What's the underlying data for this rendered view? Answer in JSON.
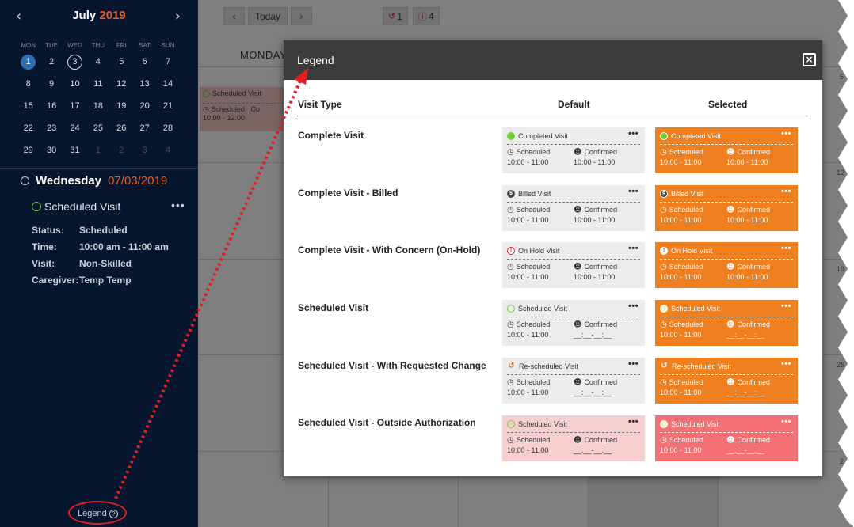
{
  "sidebar": {
    "month": "July",
    "year": "2019",
    "prev_icon": "chevron-left-icon",
    "next_icon": "chevron-right-icon",
    "weekdays": [
      "MON",
      "TUE",
      "WED",
      "THU",
      "FRI",
      "SAT",
      "SUN"
    ],
    "weeks": [
      [
        "1",
        "2",
        "3",
        "4",
        "5",
        "6",
        "7"
      ],
      [
        "8",
        "9",
        "10",
        "11",
        "12",
        "13",
        "14"
      ],
      [
        "15",
        "16",
        "17",
        "18",
        "19",
        "20",
        "21"
      ],
      [
        "22",
        "23",
        "24",
        "25",
        "26",
        "27",
        "28"
      ],
      [
        "29",
        "30",
        "31",
        "1",
        "2",
        "3",
        "4"
      ]
    ],
    "day_name": "Wednesday",
    "day_date": "07/03/2019",
    "visit_title": "Scheduled Visit",
    "visit_more": "•••",
    "details": [
      {
        "key": "Status:",
        "value": "Scheduled"
      },
      {
        "key": "Time:",
        "value": "10:00 am - 11:00 am"
      },
      {
        "key": "Visit:",
        "value": "Non-Skilled"
      },
      {
        "key": "Caregiver:",
        "value": "Temp Temp"
      }
    ],
    "legend_link": "Legend",
    "legend_icon": "question-circle-icon"
  },
  "main": {
    "today_label": "Today",
    "badge_rescheduled": "1",
    "badge_alert": "4",
    "dow_monday": "MONDAY",
    "mini_visit": {
      "title": "Scheduled Visit",
      "status": "Scheduled",
      "time": "10:00 - 12:00",
      "conf": "Co"
    },
    "day_numbers": [
      "5",
      "12",
      "19",
      "26",
      "2"
    ]
  },
  "legend": {
    "title": "Legend",
    "close_icon": "close-icon",
    "headers": {
      "type": "Visit Type",
      "default": "Default",
      "selected": "Selected"
    },
    "rows": [
      {
        "label": "Complete Visit",
        "card_title": "Completed Visit",
        "left": "Scheduled",
        "left_time": "10:00 - 11:00",
        "right": "Confirmed",
        "right_time": "10:00 - 11:00"
      },
      {
        "label": "Complete Visit - Billed",
        "card_title": "Billed Visit",
        "left": "Scheduled",
        "left_time": "10:00 - 11:00",
        "right": "Confirmed",
        "right_time": "10:00 - 11:00"
      },
      {
        "label": "Complete Visit - With Concern (On-Hold)",
        "card_title": "On Hold Visit",
        "left": "Scheduled",
        "left_time": "10:00 - 11:00",
        "right": "Confirmed",
        "right_time": "10:00 - 11:00"
      },
      {
        "label": "Scheduled Visit",
        "card_title": "Scheduled Visit",
        "left": "Scheduled",
        "left_time": "10:00 - 11:00",
        "right": "Confirmed",
        "right_time": "__:__-__:__"
      },
      {
        "label": "Scheduled Visit - With Requested Change",
        "card_title": "Re-scheduled Visit",
        "left": "Scheduled",
        "left_time": "10:00 - 11:00",
        "right": "Confirmed",
        "right_time": "__:__-__:__"
      },
      {
        "label": "Scheduled Visit - Outside Authorization",
        "card_title": "Scheduled Visit",
        "left": "Scheduled",
        "left_time": "10:00 - 11:00",
        "right": "Confirmed",
        "right_time": "__:__-__:__"
      }
    ],
    "more": "•••"
  },
  "colors": {
    "sidebar_bg": "#05162e",
    "accent_orange": "#e55a27",
    "selected_card": "#f07f1f",
    "outside_auth_default": "#f8cfcf",
    "outside_auth_selected": "#f47072",
    "annotation_red": "#e02020"
  }
}
